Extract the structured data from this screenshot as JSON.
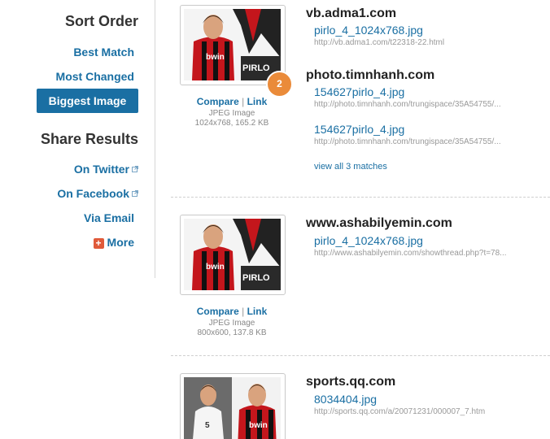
{
  "sidebar": {
    "sort_heading": "Sort Order",
    "sort_items": [
      "Best Match",
      "Most Changed",
      "Biggest Image"
    ],
    "active_sort": "Biggest Image",
    "share_heading": "Share Results",
    "share_items": [
      "On Twitter",
      "On Facebook",
      "Via Email",
      "More"
    ]
  },
  "results": [
    {
      "thumb_actions": {
        "compare": "Compare",
        "sep": "|",
        "link": "Link"
      },
      "meta_type": "JPEG Image",
      "meta_size": "1024x768, 165.2 KB",
      "badge": "2",
      "jersey_text": "bwin",
      "overlay_text": "PIRLO",
      "groups": [
        {
          "domain": "vb.adma1.com",
          "matches": [
            {
              "file": "pirlo_4_1024x768.jpg",
              "url": "http://vb.adma1.com/t22318-22.html"
            }
          ]
        },
        {
          "domain": "photo.timnhanh.com",
          "matches": [
            {
              "file": "154627pirlo_4.jpg",
              "url": "http://photo.timnhanh.com/trungispace/35A54755/..."
            },
            {
              "file": "154627pirlo_4.jpg",
              "url": "http://photo.timnhanh.com/trungispace/35A54755/..."
            }
          ],
          "view_all": "view all 3 matches"
        }
      ]
    },
    {
      "thumb_actions": {
        "compare": "Compare",
        "sep": "|",
        "link": "Link"
      },
      "meta_type": "JPEG Image",
      "meta_size": "800x600, 137.8 KB",
      "jersey_text": "bwin",
      "overlay_text": "PIRLO",
      "groups": [
        {
          "domain": "www.ashabilyemin.com",
          "matches": [
            {
              "file": "pirlo_4_1024x768.jpg",
              "url": "http://www.ashabilyemin.com/showthread.php?t=78..."
            }
          ]
        }
      ]
    },
    {
      "jersey_text": "bwin",
      "player_number": "5",
      "groups": [
        {
          "domain": "sports.qq.com",
          "matches": [
            {
              "file": "8034404.jpg",
              "url": "http://sports.qq.com/a/20071231/000007_7.htm"
            }
          ]
        }
      ]
    }
  ],
  "colors": {
    "link": "#1a6fa3",
    "active_bg": "#1a6fa3",
    "badge": "#ea8b3a",
    "jersey_red": "#c4161c"
  }
}
